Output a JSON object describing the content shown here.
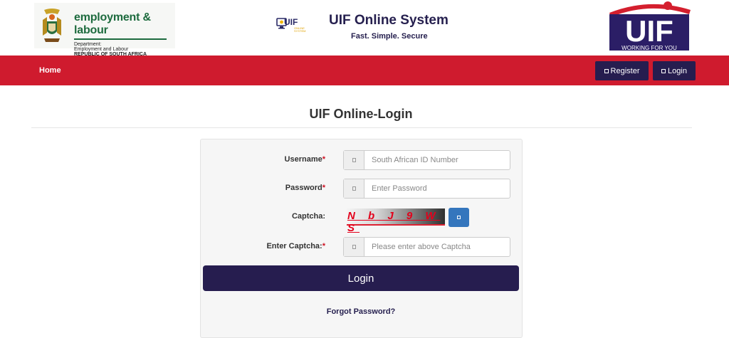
{
  "header": {
    "dept_name": "employment & labour",
    "dept_line1": "Department:",
    "dept_line2": "Employment and Labour",
    "dept_line3": "REPUBLIC OF SOUTH AFRICA",
    "mini_logo_text": "UIF",
    "mini_logo_sub1": "ONLINE",
    "mini_logo_sub2": "SYSTEM",
    "system_title": "UIF Online System",
    "tagline": "Fast. Simple. Secure",
    "uif_logo_text": "UIF",
    "uif_logo_slogan": "WORKING FOR YOU"
  },
  "nav": {
    "home": "Home",
    "register": "Register",
    "login": "Login",
    "bar_color": "#cf1b2e",
    "button_color": "#261d4f"
  },
  "main": {
    "title": "UIF Online-Login",
    "username_label": "Username",
    "username_placeholder": "South African ID Number",
    "password_label": "Password",
    "password_placeholder": "Enter Password",
    "captcha_label": "Captcha:",
    "captcha_value": "N b J 9 W S",
    "enter_captcha_label": "Enter Captcha:",
    "enter_captcha_placeholder": "Please enter above Captcha",
    "required_mark": "*",
    "login_button": "Login",
    "forgot_password": "Forgot Password?"
  }
}
